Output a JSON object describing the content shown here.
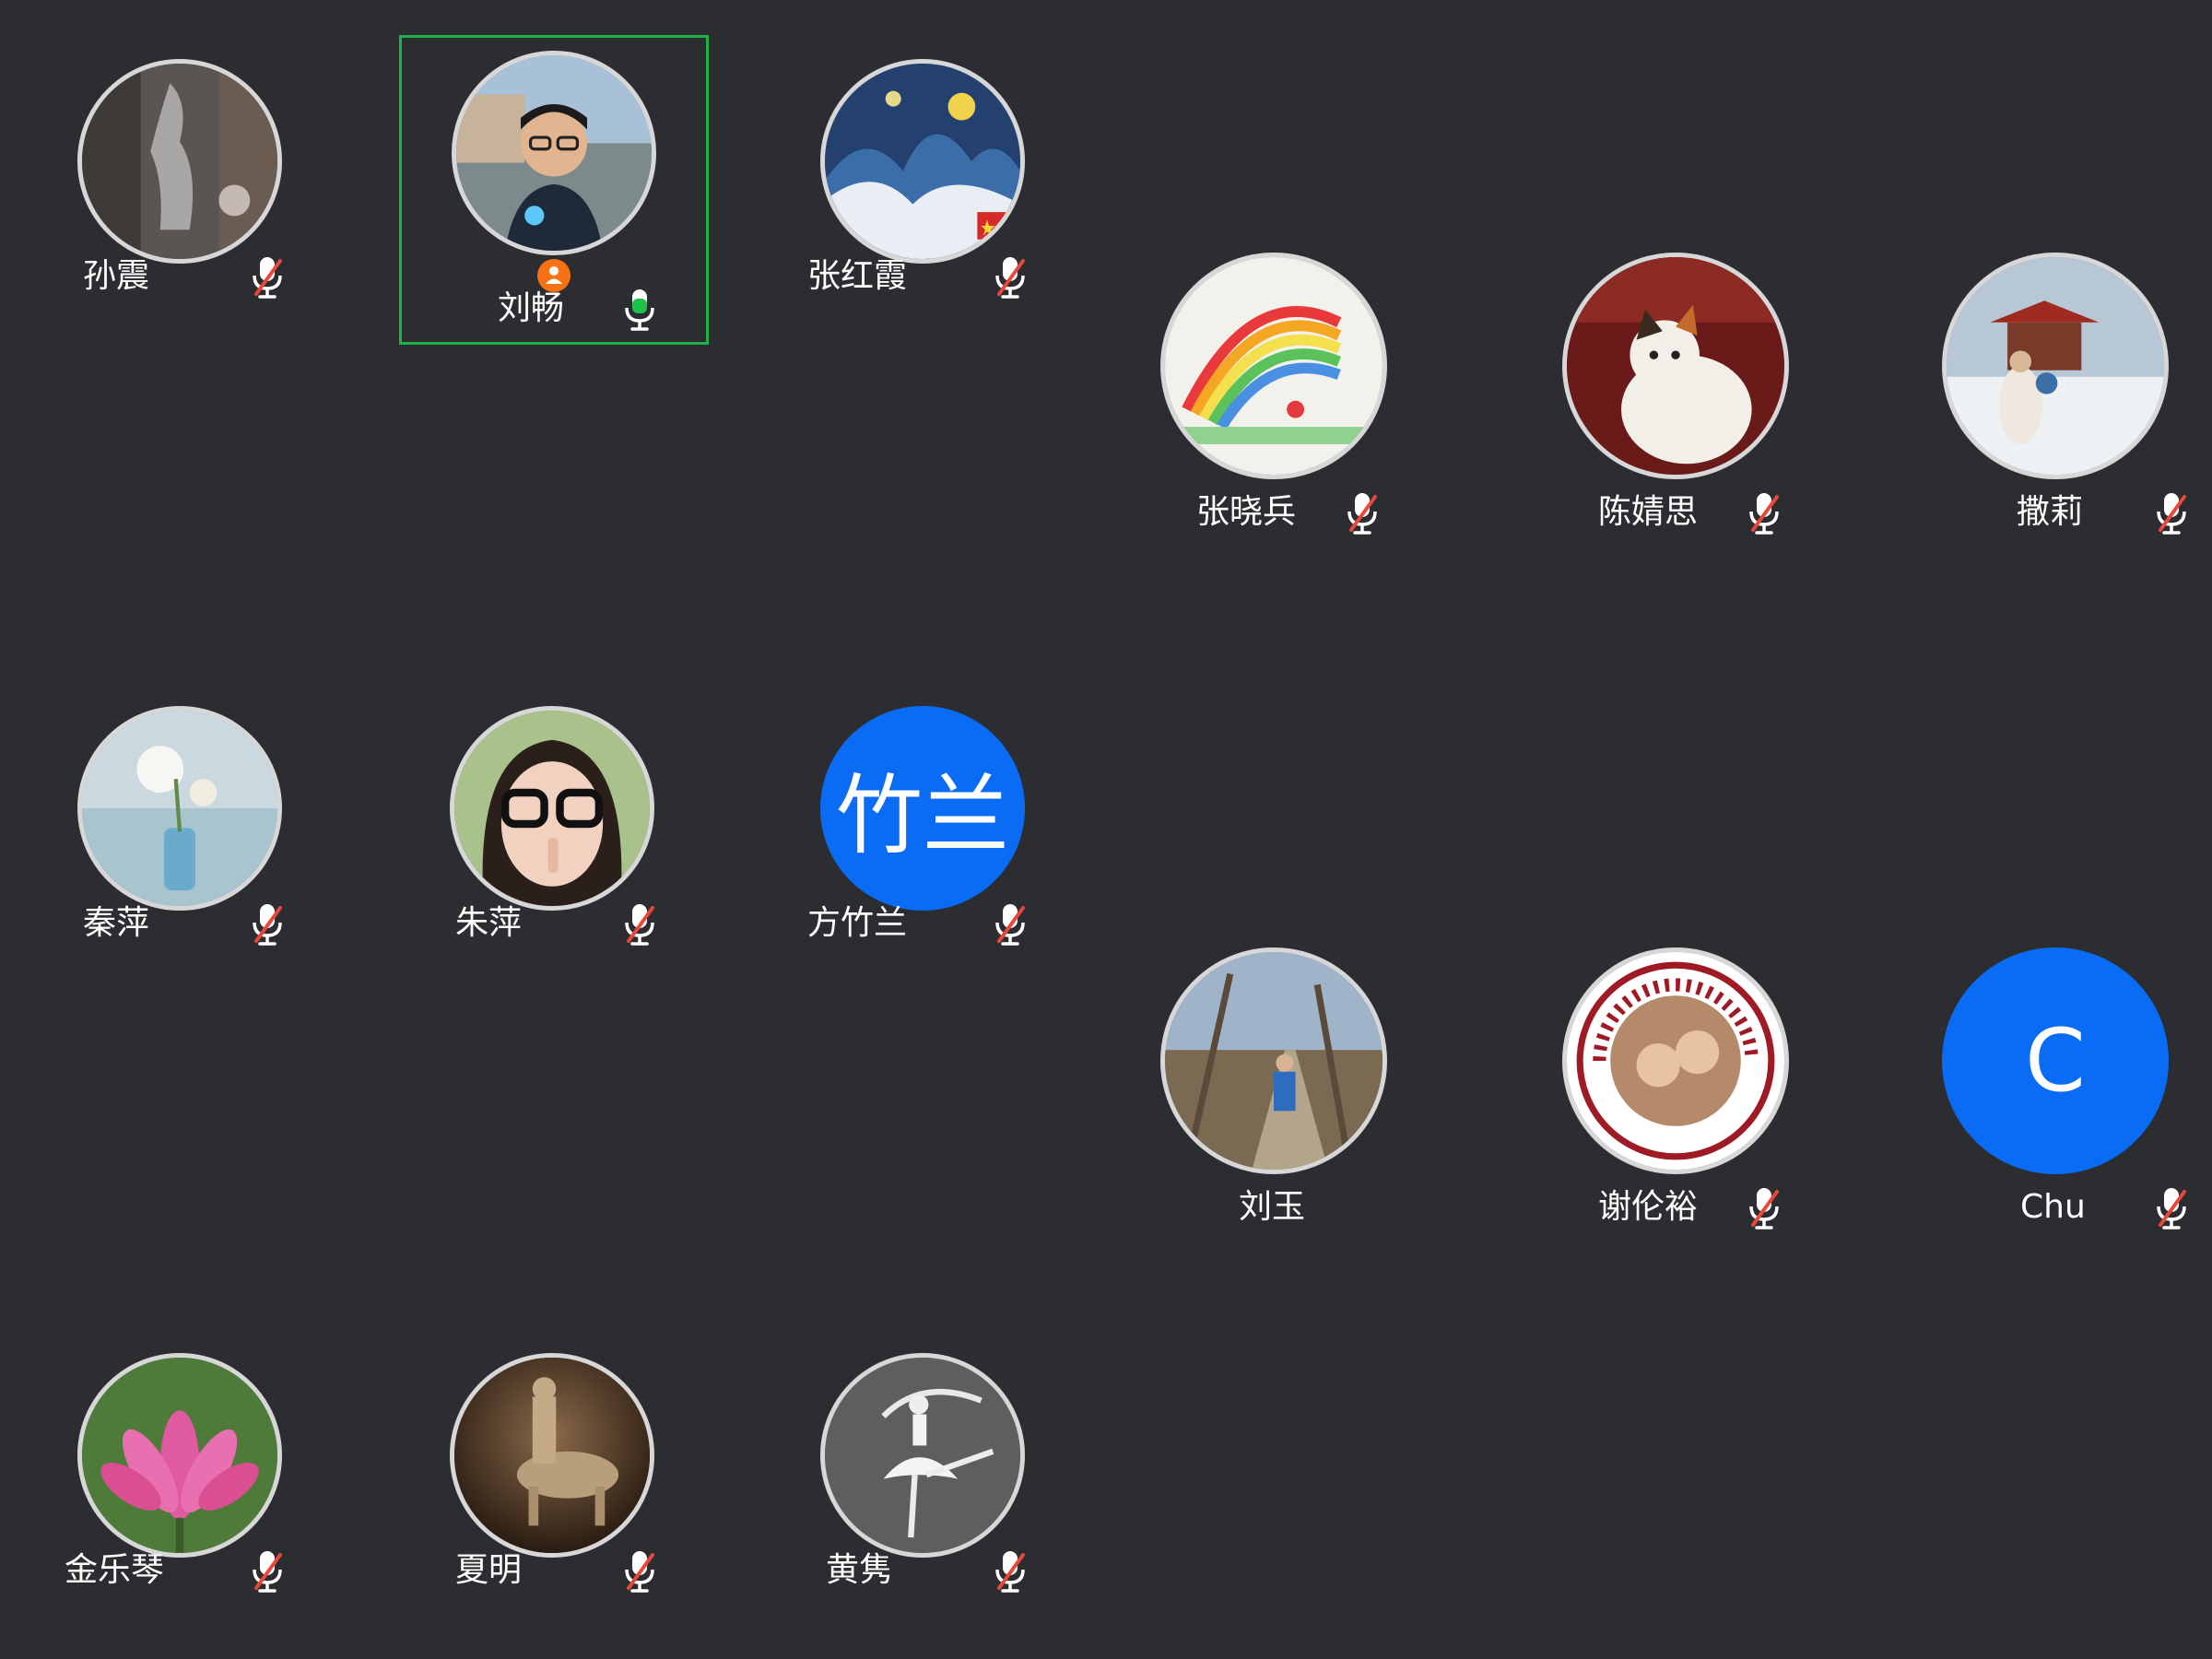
{
  "participants": [
    {
      "name": "孙震",
      "avatar": "photo",
      "avatar_subject": "sculpture",
      "mic": "muted"
    },
    {
      "name": "刘畅",
      "avatar": "photo",
      "avatar_subject": "man-selfie",
      "mic": "speaking",
      "active": true,
      "host": true
    },
    {
      "name": "张红霞",
      "avatar": "photo",
      "avatar_subject": "wave-painting",
      "mic": "muted"
    },
    {
      "name": "张晓兵",
      "avatar": "photo",
      "avatar_subject": "rainbow-drawing",
      "mic": "muted"
    },
    {
      "name": "陈婧思",
      "avatar": "photo",
      "avatar_subject": "cat",
      "mic": "muted"
    },
    {
      "name": "撒莉",
      "avatar": "photo",
      "avatar_subject": "snow-pavilion",
      "mic": "muted"
    },
    {
      "name": "秦萍",
      "avatar": "photo",
      "avatar_subject": "flower-vase",
      "mic": "muted"
    },
    {
      "name": "朱萍",
      "avatar": "photo",
      "avatar_subject": "girl-glasses",
      "mic": "muted"
    },
    {
      "name": "方竹兰",
      "avatar": "initials",
      "initials": "竹兰",
      "mic": "muted"
    },
    {
      "name": "刘玉",
      "avatar": "photo",
      "avatar_subject": "forest-path",
      "mic": "none"
    },
    {
      "name": "谢伦裕",
      "avatar": "photo",
      "avatar_subject": "university-seal",
      "mic": "muted"
    },
    {
      "name": "Chu",
      "avatar": "initials",
      "initials": "C",
      "mic": "muted"
    },
    {
      "name": "金乐琴",
      "avatar": "photo",
      "avatar_subject": "lotus",
      "mic": "muted"
    },
    {
      "name": "夏明",
      "avatar": "photo",
      "avatar_subject": "horse-statue",
      "mic": "muted"
    },
    {
      "name": "黄隽",
      "avatar": "photo",
      "avatar_subject": "ballet-dancer",
      "mic": "muted"
    }
  ],
  "colors": {
    "background": "#2b2d31",
    "active_border": "#21b14a",
    "initials_avatar": "#0a6cf5",
    "muted_slash": "#e8473b",
    "speaking_green": "#21c048",
    "host_badge": "#f67215"
  },
  "icons": {
    "mic_muted": "mic-muted-icon",
    "mic_speaking": "mic-icon",
    "host": "host-icon"
  }
}
